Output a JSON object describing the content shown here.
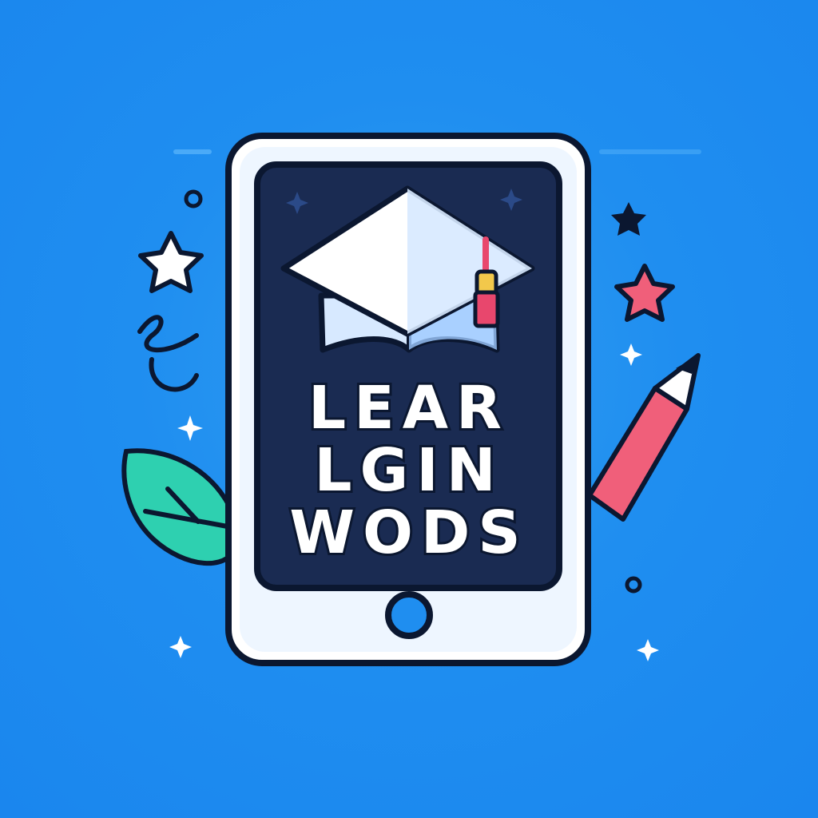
{
  "title_lines": [
    {
      "text": "LEAR"
    },
    {
      "text": "LGIN"
    },
    {
      "text": "WODS"
    }
  ],
  "colors": {
    "background": "#1f8ef0",
    "tablet_frame": "#ffffff",
    "tablet_screen": "#1a2b52",
    "outline": "#0b1730",
    "cap_blue": "#d7e9ff",
    "cap_tassel": "#e8476d",
    "pencil": "#f05f7a",
    "leaf": "#2ed0b0",
    "star_white": "#ffffff",
    "star_pink": "#f05f7a",
    "star_dark": "#0b1730"
  },
  "icons": [
    "tablet-icon",
    "graduation-cap-icon",
    "pencil-icon",
    "leaf-icon",
    "star-icon",
    "sparkle-icon",
    "home-button-icon"
  ]
}
